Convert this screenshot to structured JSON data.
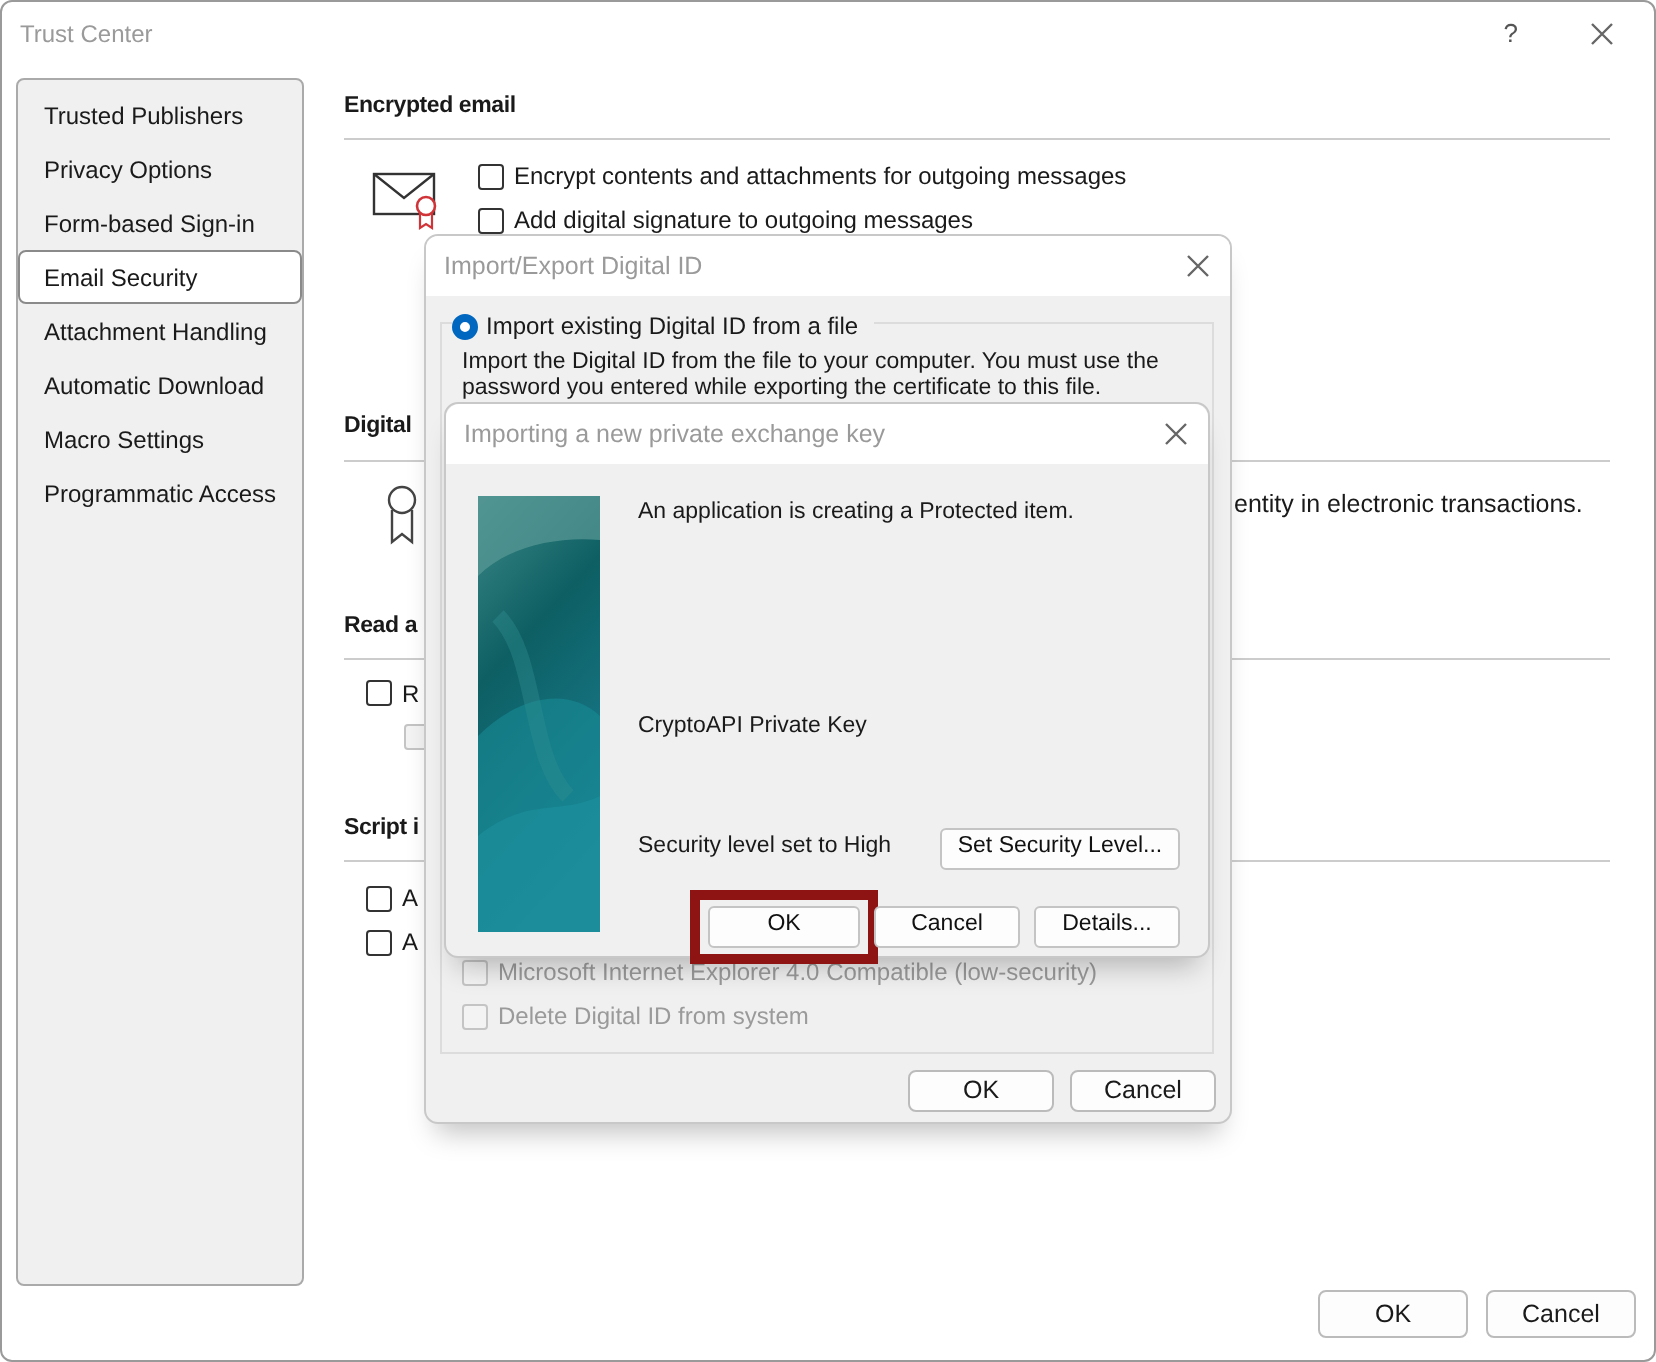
{
  "window": {
    "title": "Trust Center",
    "help": "?"
  },
  "sidebar": {
    "items": [
      {
        "label": "Trusted Publishers",
        "selected": false
      },
      {
        "label": "Privacy Options",
        "selected": false
      },
      {
        "label": "Form-based Sign-in",
        "selected": false
      },
      {
        "label": "Email Security",
        "selected": true
      },
      {
        "label": "Attachment Handling",
        "selected": false
      },
      {
        "label": "Automatic Download",
        "selected": false
      },
      {
        "label": "Macro Settings",
        "selected": false
      },
      {
        "label": "Programmatic Access",
        "selected": false
      }
    ]
  },
  "encrypted_email": {
    "heading": "Encrypted email",
    "options": [
      {
        "label": "Encrypt contents and attachments for outgoing messages",
        "checked": false
      },
      {
        "label": "Add digital signature to outgoing messages",
        "checked": false
      }
    ]
  },
  "digital_ids": {
    "heading": "Digital",
    "text": "entity in electronic transactions."
  },
  "read_as": {
    "heading": "Read a",
    "options": [
      {
        "label": "R",
        "checked": false,
        "children": [
          {
            "checked": false,
            "disabled": true
          }
        ]
      }
    ]
  },
  "script": {
    "heading": "Script i",
    "options": [
      {
        "label": "A",
        "checked": false
      },
      {
        "label": "A",
        "checked": false
      }
    ]
  },
  "buttons": [
    {
      "label": "OK"
    },
    {
      "label": "Cancel"
    }
  ],
  "import_export_dialog": {
    "title": "Import/Export Digital ID",
    "radio": {
      "label": "Import existing Digital ID from a file",
      "selected": true
    },
    "description": "Import the Digital ID from the file to your computer. You must use the password you entered while exporting the certificate to this file.",
    "options": [
      {
        "label": "Microsoft Internet Explorer 4.0 Compatible (low-security)",
        "checked": false,
        "disabled": true
      },
      {
        "label": "Delete Digital ID from system",
        "checked": false,
        "disabled": true
      }
    ],
    "buttons": [
      {
        "label": "OK"
      },
      {
        "label": "Cancel"
      }
    ]
  },
  "key_dialog": {
    "title": "Importing a new private exchange key",
    "message": "An application is creating a Protected item.",
    "item_name": "CryptoAPI Private Key",
    "security_text": "Security level set to High",
    "set_level_button": "Set Security Level...",
    "buttons": [
      {
        "label": "OK",
        "highlighted": true
      },
      {
        "label": "Cancel",
        "highlighted": false
      },
      {
        "label": "Details...",
        "highlighted": false
      }
    ]
  }
}
